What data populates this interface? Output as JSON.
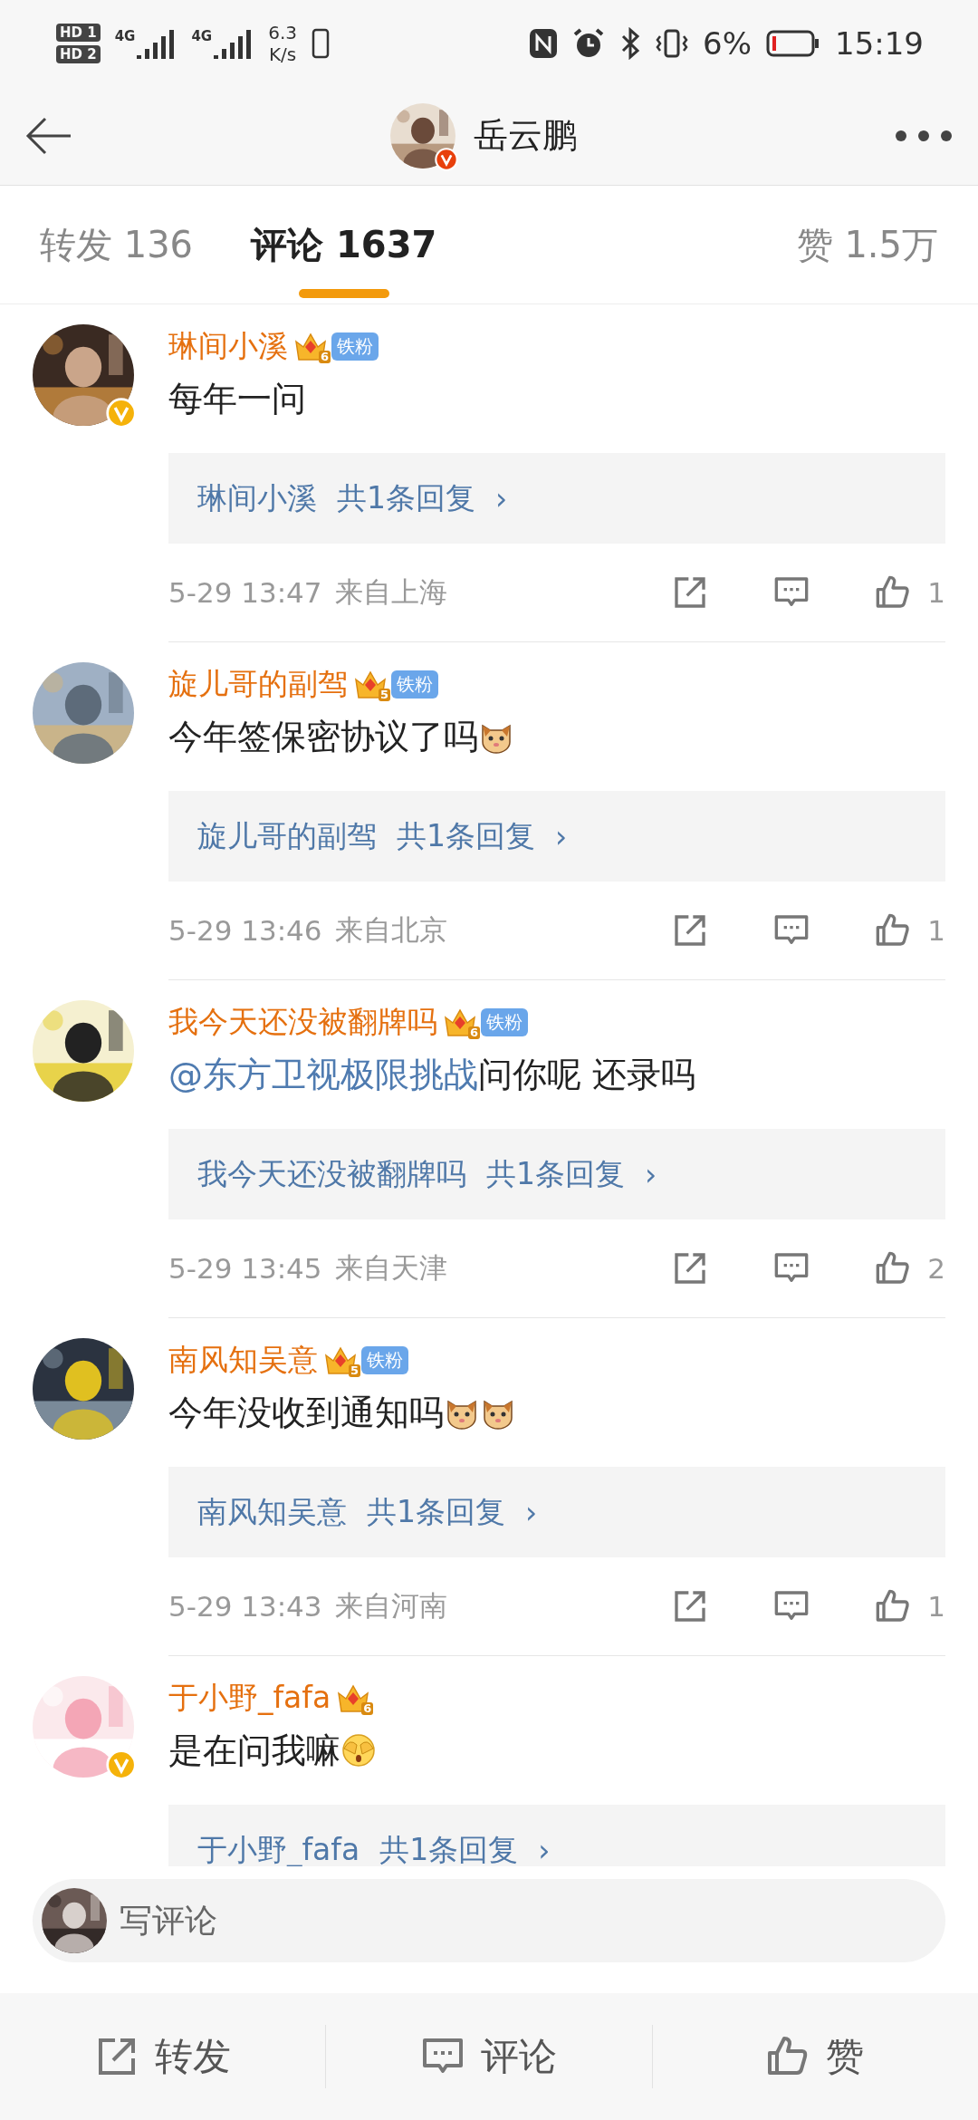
{
  "status_bar": {
    "sims": [
      {
        "label": "HD",
        "slot": "1"
      },
      {
        "label": "HD",
        "slot": "2"
      }
    ],
    "networks": [
      "4G",
      "4G"
    ],
    "speed": "6.3",
    "speed_unit": "K/s",
    "battery": "6%",
    "time": "15:19"
  },
  "header": {
    "title": "岳云鹏",
    "verified": true
  },
  "tabs": [
    {
      "label": "转发 136",
      "selected": false
    },
    {
      "label": "评论 1637",
      "selected": true
    },
    {
      "label": "赞 1.5万",
      "selected": false
    }
  ],
  "comments": [
    {
      "name": "琳间小溪",
      "verified": true,
      "badge": {
        "level": "6",
        "label": "铁粉"
      },
      "body": [
        {
          "kind": "text",
          "text": "每年一问"
        }
      ],
      "reply": {
        "name": "琳间小溪",
        "count": "共1条回复",
        "arrow": "›"
      },
      "time": "5-29 13:47",
      "location": "来自上海",
      "likes": "1"
    },
    {
      "name": "旋儿哥的副驾",
      "verified": false,
      "badge": {
        "level": "5",
        "label": "铁粉"
      },
      "body": [
        {
          "kind": "text",
          "text": "今年签保密协议了吗"
        },
        {
          "kind": "cat"
        }
      ],
      "reply": {
        "name": "旋儿哥的副驾",
        "count": "共1条回复",
        "arrow": "›"
      },
      "time": "5-29 13:46",
      "location": "来自北京",
      "likes": "1"
    },
    {
      "name": "我今天还没被翻牌吗",
      "verified": false,
      "badge": {
        "level": "6",
        "label": "铁粉"
      },
      "body": [
        {
          "kind": "mention",
          "text": "@东方卫视极限挑战"
        },
        {
          "kind": "text",
          "text": " 问你呢 还录吗"
        }
      ],
      "reply": {
        "name": "我今天还没被翻牌吗",
        "count": "共1条回复",
        "arrow": "›"
      },
      "time": "5-29 13:45",
      "location": "来自天津",
      "likes": "2"
    },
    {
      "name": "南风知吴意",
      "verified": false,
      "badge": {
        "level": "5",
        "label": "铁粉"
      },
      "body": [
        {
          "kind": "text",
          "text": "今年没收到通知吗"
        },
        {
          "kind": "cat"
        },
        {
          "kind": "cat"
        }
      ],
      "reply": {
        "name": "南风知吴意",
        "count": "共1条回复",
        "arrow": "›"
      },
      "time": "5-29 13:43",
      "location": "来自河南",
      "likes": "1"
    },
    {
      "name": "于小野_fafa",
      "verified": true,
      "badge": {
        "level": "6"
      },
      "body": [
        {
          "kind": "text",
          "text": "是在问我嘛"
        },
        {
          "kind": "cover"
        }
      ],
      "reply": {
        "name": "于小野_fafa",
        "count": "共1条回复",
        "arrow": "›"
      }
    }
  ],
  "composer": {
    "placeholder": "写评论"
  },
  "actions": [
    {
      "kind": "share",
      "label": "转发"
    },
    {
      "kind": "comment",
      "label": "评论"
    },
    {
      "kind": "like",
      "label": "赞"
    }
  ]
}
